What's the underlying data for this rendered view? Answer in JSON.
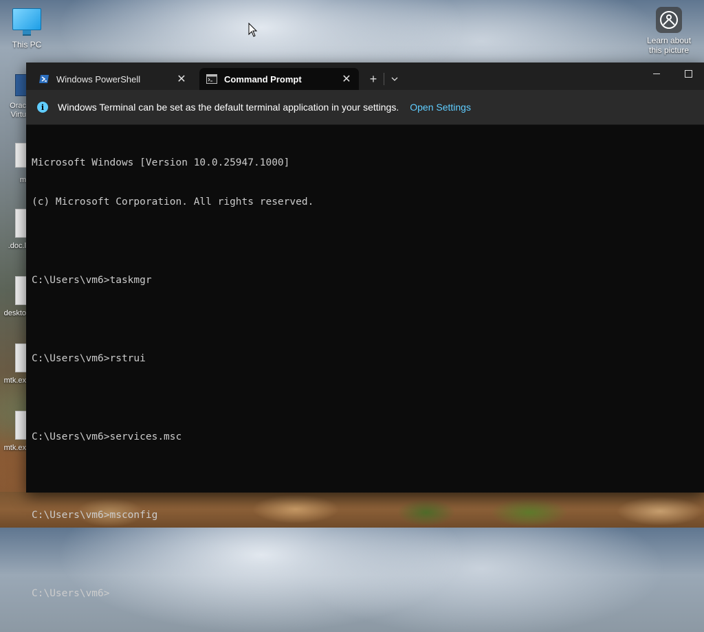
{
  "desktop": {
    "this_pc_label": "This PC",
    "side_labels": [
      "Orac\nVirtu",
      "m",
      ".doc.l",
      "deskto",
      "mtk.ex",
      "mtk.ex"
    ],
    "learn_label_line1": "Learn about",
    "learn_label_line2": "this picture"
  },
  "terminal": {
    "tabs": [
      {
        "title": "Windows PowerShell",
        "icon": "powershell-icon",
        "active": false
      },
      {
        "title": "Command Prompt",
        "icon": "cmd-icon",
        "active": true
      }
    ],
    "new_tab_label": "+",
    "dropdown_label": "⌄",
    "infobar": {
      "message": "Windows Terminal can be set as the default terminal application in your settings.",
      "link": "Open Settings"
    },
    "console_lines": [
      "Microsoft Windows [Version 10.0.25947.1000]",
      "(c) Microsoft Corporation. All rights reserved.",
      "",
      "C:\\Users\\vm6>taskmgr",
      "",
      "C:\\Users\\vm6>rstrui",
      "",
      "C:\\Users\\vm6>services.msc",
      "",
      "C:\\Users\\vm6>msconfig",
      "",
      "C:\\Users\\vm6>"
    ]
  },
  "colors": {
    "accent": "#60cdff",
    "console_bg": "#0c0c0c",
    "tabbar_bg": "#202020",
    "console_text": "#cccccc"
  }
}
